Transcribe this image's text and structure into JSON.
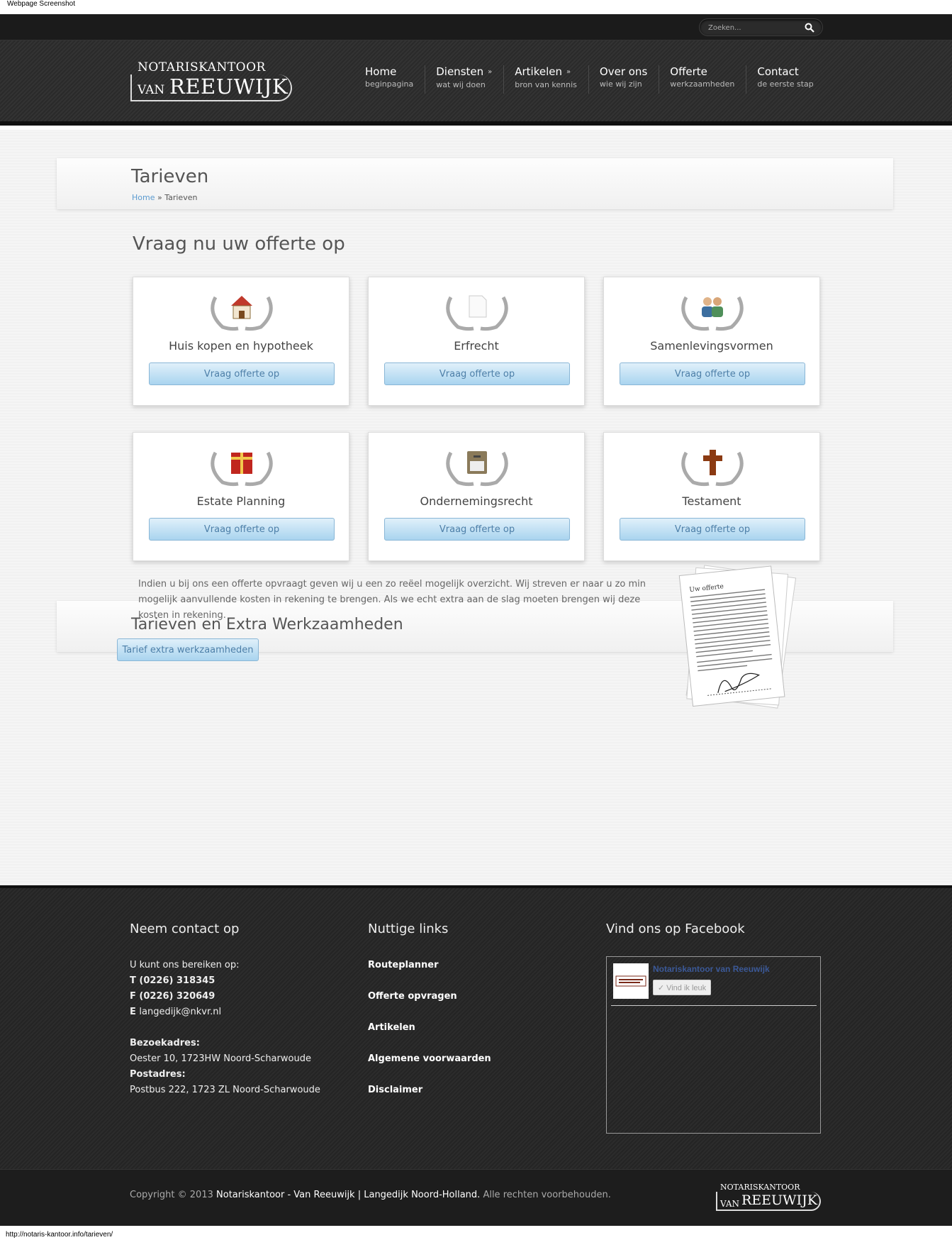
{
  "screenshot_label": "Webpage Screenshot",
  "status_url": "http://notaris-kantoor.info/tarieven/",
  "search": {
    "placeholder": "Zoeken..."
  },
  "logo": {
    "top": "NOTARISKANTOOR",
    "van": "VAN",
    "name": "REEUWIJK"
  },
  "nav": [
    {
      "title": "Home",
      "sub": "beginpagina"
    },
    {
      "title": "Diensten",
      "sub": "wat wij doen"
    },
    {
      "title": "Artikelen",
      "sub": "bron van kennis"
    },
    {
      "title": "Over ons",
      "sub": "wie wij zijn"
    },
    {
      "title": "Offerte",
      "sub": "werkzaamheden"
    },
    {
      "title": "Contact",
      "sub": "de eerste stap"
    }
  ],
  "page": {
    "title": "Tarieven",
    "breadcrumb_home": "Home",
    "breadcrumb_sep": " » ",
    "breadcrumb_current": "Tarieven",
    "heading": "Vraag nu uw offerte op"
  },
  "cards": [
    {
      "label": "Huis kopen en hypotheek",
      "button": "Vraag offerte op",
      "icon": "house-icon"
    },
    {
      "label": "Erfrecht",
      "button": "Vraag offerte op",
      "icon": "document-icon"
    },
    {
      "label": "Samenlevingsvormen",
      "button": "Vraag offerte op",
      "icon": "people-icon"
    },
    {
      "label": "Estate Planning",
      "button": "Vraag offerte op",
      "icon": "gift-icon"
    },
    {
      "label": "Ondernemingsrecht",
      "button": "Vraag offerte op",
      "icon": "cabinet-icon"
    },
    {
      "label": "Testament",
      "button": "Vraag offerte op",
      "icon": "cross-icon"
    }
  ],
  "extra": {
    "title": "Tarieven en Extra Werkzaamheden",
    "text": "Indien u bij ons een offerte opvraagt geven wij u een zo reëel mogelijk overzicht. Wij streven er naar u zo min mogelijk aanvullende kosten in rekening te brengen. Als we echt extra aan de slag moeten brengen wij deze kosten in rekening.",
    "button": "Tarief extra werkzaamheden",
    "paper_title": "Uw offerte"
  },
  "footer": {
    "contact_title": "Neem contact op",
    "reach": "U kunt ons bereiken op:",
    "phone": "T (0226) 318345",
    "fax": "F (0226) 320649",
    "email_prefix": "E ",
    "email": "langedijk@nkvr.nl",
    "visit_label": "Bezoekadres:",
    "visit": "Oester 10, 1723HW Noord-Scharwoude",
    "post_label": "Postadres:",
    "post": "Postbus 222, 1723 ZL Noord-Scharwoude",
    "links_title": "Nuttige links",
    "links": [
      "Routeplanner",
      "Offerte opvragen",
      "Artikelen",
      "Algemene voorwaarden",
      "Disclaimer"
    ],
    "fb_title": "Vind ons op Facebook",
    "fb_name": "Notariskantoor van Reeuwijk",
    "fb_like": "✓ Vind ik leuk"
  },
  "bottom": {
    "copy_prefix": "Copyright © 2013 ",
    "copy_name": "Notariskantoor - Van Reeuwijk | Langedijk Noord-Holland.",
    "copy_suffix": " Alle rechten voorbehouden."
  },
  "colors": {
    "link_blue": "#5b9bd0",
    "button_text": "#4d7fa8",
    "facebook": "#3b5998"
  }
}
